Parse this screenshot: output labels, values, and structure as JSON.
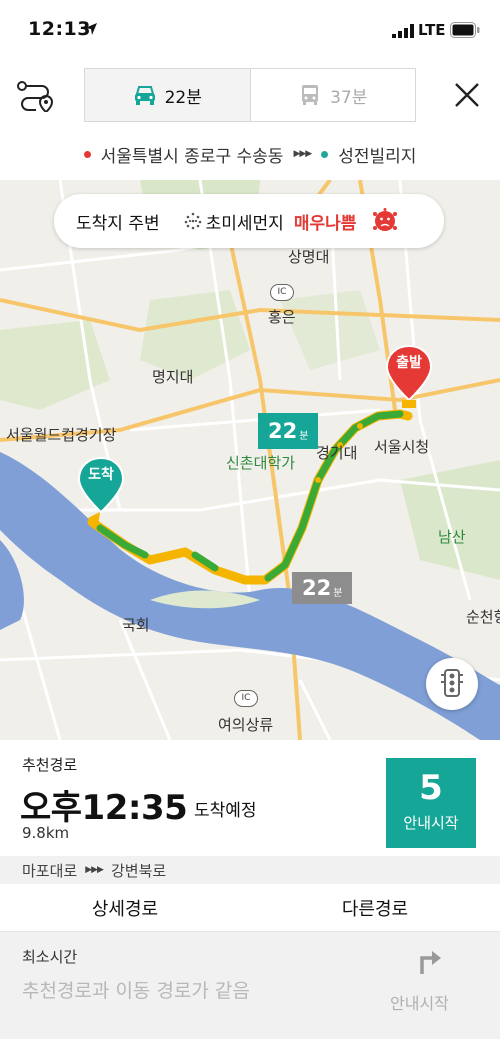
{
  "status_bar": {
    "time": "12:13",
    "network": "LTE"
  },
  "mode_tabs": [
    {
      "label": "22분",
      "icon": "car-icon",
      "selected": true
    },
    {
      "label": "37분",
      "icon": "bus-icon",
      "selected": false
    }
  ],
  "route": {
    "origin": "서울특별시 종로구 수송동",
    "destination": "성전빌리지"
  },
  "map": {
    "info_pill": {
      "nearby": "도착지 주변",
      "dust_label": "초미세먼지",
      "dust_level": "매우나쁨"
    },
    "labels": {
      "sangmyeongdae": "상명대",
      "hongeun": "홍은",
      "myongji": "명지대",
      "worldcup": "서울월드컵경기장",
      "sinchon": "신촌대학가",
      "gyeonggidae": "경기대",
      "cityhall": "서울시청",
      "namsan": "남산",
      "suncheon": "순천향",
      "national": "국회",
      "yeouido": "여의상류",
      "ic1": "IC",
      "ic2": "IC"
    },
    "main_route_time": "22",
    "main_route_unit": "분",
    "alt_route_time": "22",
    "alt_route_unit": "분",
    "start_marker": "출발",
    "end_marker": "도착",
    "colors": {
      "accent": "#16a697",
      "start": "#e53935",
      "traffic_good": "#3aa935",
      "traffic_slow": "#f5b400"
    }
  },
  "summary": {
    "label": "추천경로",
    "eta": "오후12:35",
    "eta_suffix": "도착예정",
    "distance": "9.8km",
    "start_count": "5",
    "start_label": "안내시작",
    "roads": [
      "마포대로",
      "강변북로"
    ]
  },
  "tabs": {
    "detail": "상세경로",
    "other": "다른경로"
  },
  "alt_route": {
    "title": "최소시간",
    "desc": "추천경로과 이동 경로가 같음",
    "guide": "안내시작"
  }
}
